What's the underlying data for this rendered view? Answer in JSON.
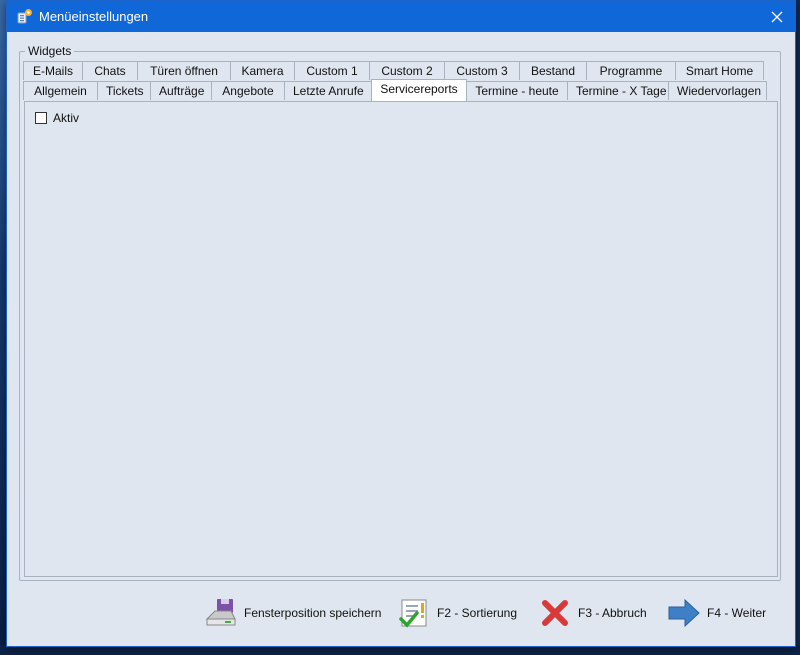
{
  "window": {
    "title": "Menüeinstellungen",
    "app_icon": "settings-app-icon",
    "close_icon": "close-icon"
  },
  "group": {
    "label": "Widgets"
  },
  "tabs_row1": [
    "E-Mails",
    "Chats",
    "Türen öffnen",
    "Kamera",
    "Custom 1",
    "Custom 2",
    "Custom 3",
    "Bestand",
    "Programme",
    "Smart Home"
  ],
  "tabs_row2": [
    "Allgemein",
    "Tickets",
    "Aufträge",
    "Angebote",
    "Letzte Anrufe",
    "Servicereports",
    "Termine - heute",
    "Termine - X Tage",
    "Wiedervorlagen"
  ],
  "active_tab": "Servicereports",
  "panel": {
    "checkbox_label": "Aktiv",
    "checkbox_checked": false
  },
  "buttons": {
    "save_position": "Fensterposition speichern",
    "sort": "F2 - Sortierung",
    "cancel": "F3 - Abbruch",
    "next": "F4 - Weiter"
  },
  "colors": {
    "titlebar": "#1068d8",
    "window_bg": "#dfe6ef",
    "border": "#a9b3bf",
    "cancel_red": "#d83a3a",
    "next_blue": "#3f7fc6"
  }
}
